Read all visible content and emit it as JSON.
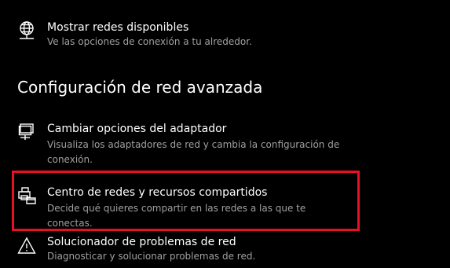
{
  "items": [
    {
      "title": "Mostrar redes disponibles",
      "description": "Ve las opciones de conexión a tu alrededor.",
      "icon": "globe-network-icon"
    },
    {
      "title": "Cambiar opciones del adaptador",
      "description": "Visualiza los adaptadores de red y cambia la configuración de conexión.",
      "icon": "monitor-network-icon"
    },
    {
      "title": "Centro de redes y recursos compartidos",
      "description": "Decide qué quieres compartir en las redes a las que te conectas.",
      "icon": "printer-folder-icon"
    },
    {
      "title": "Solucionador de problemas de red",
      "description": "Diagnosticar y solucionar problemas de red.",
      "icon": "warning-triangle-icon"
    }
  ],
  "section_heading": "Configuración de red avanzada",
  "colors": {
    "background": "#000000",
    "title_text": "#ffffff",
    "description_text": "#a0a0a0",
    "highlight_border": "#e81123"
  }
}
